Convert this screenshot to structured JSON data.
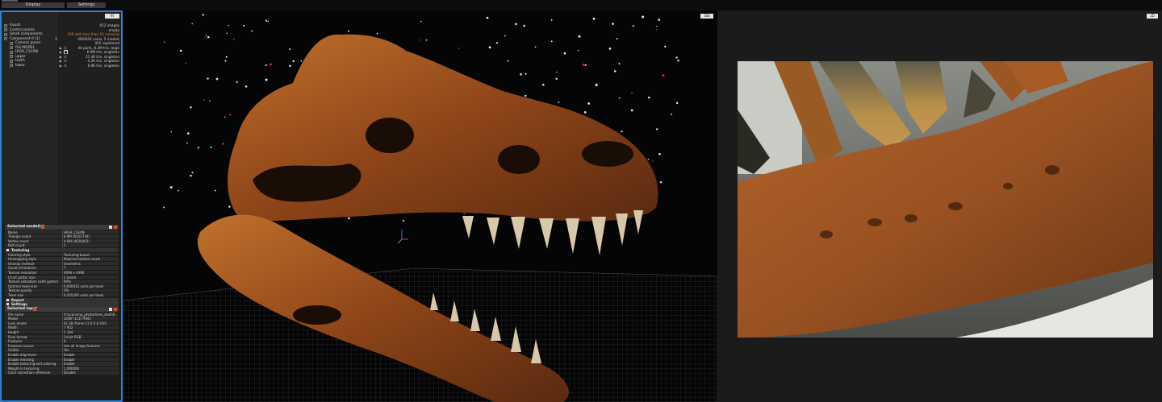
{
  "tabs": {
    "display": "Display",
    "settings": "Settings"
  },
  "tree": {
    "header_btn": "fit",
    "rows": [
      {
        "label": "Inputs",
        "value": "652 images",
        "warn": false
      },
      {
        "label": "Control points",
        "value": "empty",
        "warn": false
      },
      {
        "label": "Small components",
        "value": "106 with less than 10 cameras",
        "warn": true
      },
      {
        "label": "Component 0 [1]",
        "value": "402/652 cams, 5 models",
        "warn": false
      },
      {
        "label": "Camera poses",
        "value": "402 registered",
        "warn": false
      },
      {
        "label": "OG MODEL",
        "value": "44 parts, 8.3M tris, large",
        "warn": false
      },
      {
        "label": "HIGH_CLEAN",
        "value": "6.9M tris, singleton",
        "warn": false
      },
      {
        "label": "upper",
        "value": "21.4K tris, singleton",
        "warn": false
      },
      {
        "label": "teeth",
        "value": "4.2K tris, singleton",
        "warn": false
      },
      {
        "label": "lower",
        "value": "6.9K tris, singleton",
        "warn": false
      }
    ]
  },
  "selected_model": {
    "title": "Selected model(s)",
    "rows": [
      {
        "k": "Name",
        "v": "HIGH_CLEAN"
      },
      {
        "k": "Triangle count",
        "v": "6.9M (9252734)"
      },
      {
        "k": "Vertex count",
        "v": "4.6M (4626402)"
      },
      {
        "k": "Part count",
        "v": "1"
      }
    ],
    "texturing_title": "Texturing",
    "texturing_rows": [
      {
        "k": "Coloring style",
        "v": "Texturing-based"
      },
      {
        "k": "Unwrapping style",
        "v": "Maximal texture count"
      },
      {
        "k": "Unwrap method",
        "v": "Geometric"
      },
      {
        "k": "Count of textures",
        "v": "7"
      },
      {
        "k": "Texture resolution",
        "v": "4096 x 4096"
      },
      {
        "k": "Chart gutter size",
        "v": "2 texels"
      },
      {
        "k": "Texture utilization (with gutter)",
        "v": "90%"
      },
      {
        "k": "Optimal texel size",
        "v": "0.000035 units per texel"
      },
      {
        "k": "Texture quality",
        "v": "3%"
      },
      {
        "k": "Texel size",
        "v": "0.035292 units per texel"
      }
    ],
    "report": "Report",
    "settings": "Settings"
  },
  "selected_input": {
    "title": "Selected input",
    "rows": [
      {
        "k": "File name",
        "v": "X:\\scanning_photos\\trex_skull\\P..."
      },
      {
        "k": "Model",
        "v": "SONY ILCE-7RM2"
      },
      {
        "k": "Lens model",
        "v": "FE 28-70mm F3.5-5.6 OSS"
      },
      {
        "k": "Width",
        "v": "7 952"
      },
      {
        "k": "Height",
        "v": "5 304"
      },
      {
        "k": "Pixel format",
        "v": "24-bit RGB"
      },
      {
        "k": "Features",
        "v": "0"
      },
      {
        "k": "Features source",
        "v": "Use all image features"
      },
      {
        "k": "Visible",
        "v": "Yes"
      },
      {
        "k": "Enable alignment",
        "v": "Enable"
      },
      {
        "k": "Enable meshing",
        "v": "Enable"
      },
      {
        "k": "Enable texturing and coloring",
        "v": "Enable"
      },
      {
        "k": "Weight in texturing",
        "v": "1.000000"
      },
      {
        "k": "Color correction reference",
        "v": "Disable"
      }
    ]
  },
  "viewport3d": {
    "mode_btn": "3Ds"
  },
  "viewport2d": {
    "mode_btn": "2D"
  },
  "colors": {
    "accent": "#2f7fd6",
    "warn": "#e08a2e",
    "bone": "#a8571f"
  }
}
